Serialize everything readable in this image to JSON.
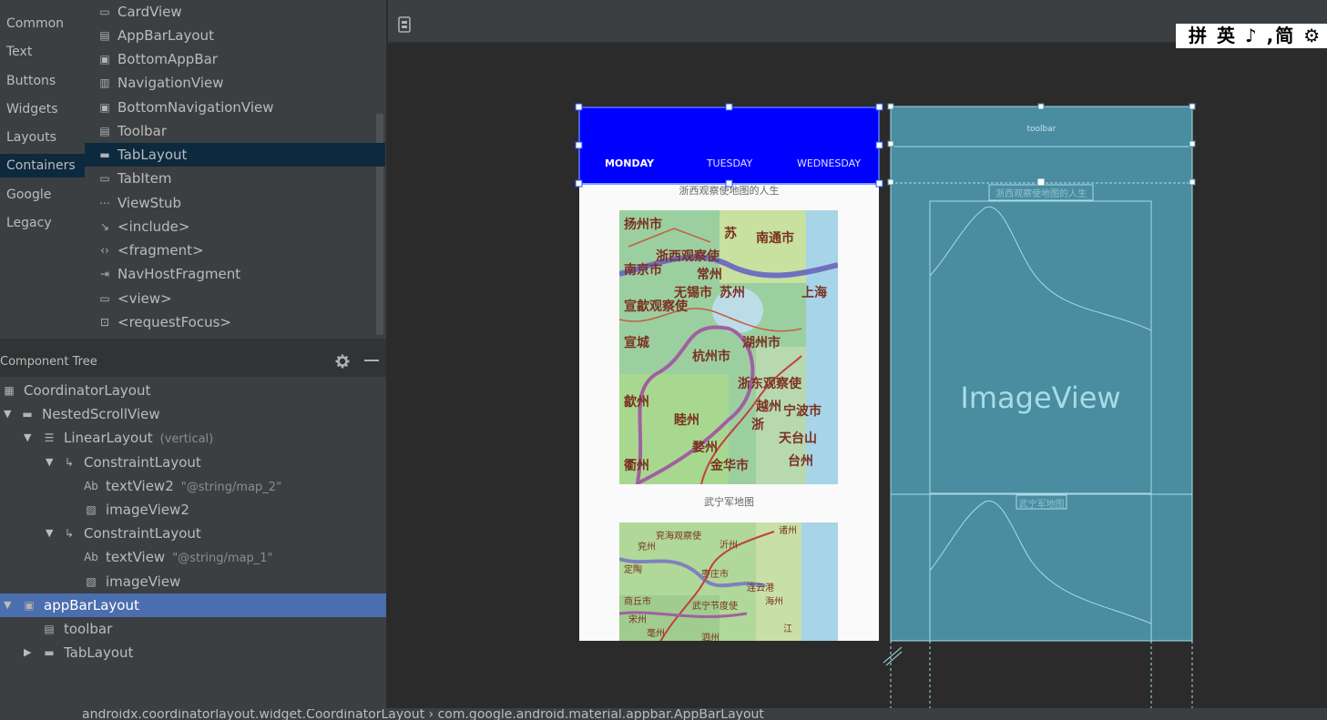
{
  "palette": {
    "categories": [
      "Common",
      "Text",
      "Buttons",
      "Widgets",
      "Layouts",
      "Containers",
      "Google",
      "Legacy"
    ],
    "selected_category": "Containers",
    "items": [
      {
        "label": "CardView",
        "icon": "cardview-icon"
      },
      {
        "label": "AppBarLayout",
        "icon": "appbarlayout-icon"
      },
      {
        "label": "BottomAppBar",
        "icon": "bottomappbar-icon"
      },
      {
        "label": "NavigationView",
        "icon": "navigationview-icon"
      },
      {
        "label": "BottomNavigationView",
        "icon": "bottomnavigationview-icon"
      },
      {
        "label": "Toolbar",
        "icon": "toolbar-icon"
      },
      {
        "label": "TabLayout",
        "icon": "tablayout-icon"
      },
      {
        "label": "TabItem",
        "icon": "tabitem-icon"
      },
      {
        "label": "ViewStub",
        "icon": "viewstub-icon"
      },
      {
        "label": "<include>",
        "icon": "include-icon"
      },
      {
        "label": "<fragment>",
        "icon": "fragment-icon"
      },
      {
        "label": "NavHostFragment",
        "icon": "navhostfragment-icon"
      },
      {
        "label": "<view>",
        "icon": "view-icon"
      },
      {
        "label": "<requestFocus>",
        "icon": "requestfocus-icon"
      }
    ],
    "selected_item": "TabLayout"
  },
  "component_tree": {
    "title": "Component Tree",
    "nodes": [
      {
        "label": "CoordinatorLayout",
        "hint": "",
        "icon": "coordinatorlayout-icon",
        "arrow": ""
      },
      {
        "label": "NestedScrollView",
        "hint": "",
        "icon": "scrollview-icon",
        "arrow": "▼"
      },
      {
        "label": "LinearLayout",
        "hint": "(vertical)",
        "icon": "linearlayout-icon",
        "arrow": "▼"
      },
      {
        "label": "ConstraintLayout",
        "hint": "",
        "icon": "constraintlayout-icon",
        "arrow": "▼"
      },
      {
        "label": "textView2",
        "hint": "\"@string/map_2\"",
        "icon": "textview-icon",
        "arrow": ""
      },
      {
        "label": "imageView2",
        "hint": "",
        "icon": "imageview-icon",
        "arrow": ""
      },
      {
        "label": "ConstraintLayout",
        "hint": "",
        "icon": "constraintlayout-icon",
        "arrow": "▼"
      },
      {
        "label": "textView",
        "hint": "\"@string/map_1\"",
        "icon": "textview-icon",
        "arrow": ""
      },
      {
        "label": "imageView",
        "hint": "",
        "icon": "imageview-icon",
        "arrow": ""
      },
      {
        "label": "appBarLayout",
        "hint": "",
        "icon": "appbarlayout-icon",
        "arrow": "▼"
      },
      {
        "label": "toolbar",
        "hint": "",
        "icon": "toolbar-icon",
        "arrow": ""
      },
      {
        "label": "TabLayout",
        "hint": "",
        "icon": "tablayout-icon",
        "arrow": "▶"
      }
    ],
    "selected": "appBarLayout"
  },
  "ime": {
    "text": "拼 英 ♪ ,简 ⚙"
  },
  "preview": {
    "tabs": [
      "MONDAY",
      "TUESDAY",
      "WEDNESDAY"
    ],
    "active_tab": "MONDAY",
    "caption1": "浙西观察使地图的人生",
    "caption2": "武宁军地图",
    "colors": {
      "appbar": "#0000ff",
      "phone_bg": "#fafafa"
    }
  },
  "blueprint": {
    "toolbar_label": "toolbar",
    "caption1": "浙西观察使地图的人生",
    "caption2": "武宁军地图",
    "image_label": "ImageView",
    "colors": {
      "bg": "#4a8ca0",
      "line": "#a8dbe8"
    }
  },
  "status": {
    "breadcrumb": "androidx.coordinatorlayout.widget.CoordinatorLayout  ›  com.google.android.material.appbar.AppBarLayout"
  }
}
